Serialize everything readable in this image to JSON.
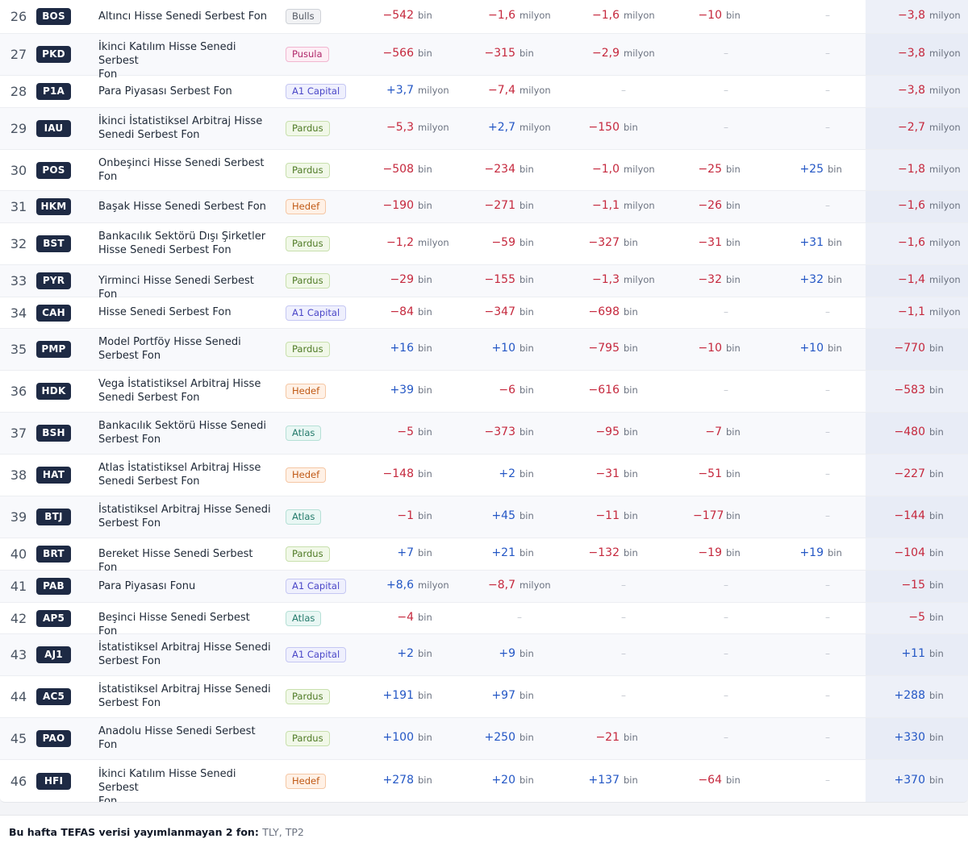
{
  "rows": [
    {
      "rank": "26",
      "ticker": "BOS",
      "name": [
        "Altıncı Hisse Senedi Serbest Fon"
      ],
      "manager": "Bulls",
      "mgr_class": "bulls",
      "cells": [
        [
          "−542",
          "bin"
        ],
        [
          "−1,6",
          "milyon"
        ],
        [
          "−1,6",
          "milyon"
        ],
        [
          "−10",
          "bin"
        ],
        [
          "–",
          ""
        ],
        [
          "−3,8",
          "milyon"
        ]
      ]
    },
    {
      "rank": "27",
      "ticker": "PKD",
      "name": [
        "İkinci Katılım Hisse Senedi Serbest",
        "Fon"
      ],
      "manager": "Pusula",
      "mgr_class": "pusula",
      "cells": [
        [
          "−566",
          "bin"
        ],
        [
          "−315",
          "bin"
        ],
        [
          "−2,9",
          "milyon"
        ],
        [
          "–",
          ""
        ],
        [
          "–",
          ""
        ],
        [
          "−3,8",
          "milyon"
        ]
      ]
    },
    {
      "rank": "28",
      "ticker": "P1A",
      "name": [
        "Para Piyasası Serbest Fon"
      ],
      "manager": "A1 Capital",
      "mgr_class": "a1",
      "cells": [
        [
          "+3,7",
          "milyon"
        ],
        [
          "−7,4",
          "milyon"
        ],
        [
          "–",
          ""
        ],
        [
          "–",
          ""
        ],
        [
          "–",
          ""
        ],
        [
          "−3,8",
          "milyon"
        ]
      ]
    },
    {
      "rank": "29",
      "ticker": "IAU",
      "name": [
        "İkinci İstatistiksel Arbitraj Hisse",
        "Senedi Serbest Fon"
      ],
      "manager": "Pardus",
      "mgr_class": "pardus",
      "cells": [
        [
          "−5,3",
          "milyon"
        ],
        [
          "+2,7",
          "milyon"
        ],
        [
          "−150",
          "bin"
        ],
        [
          "–",
          ""
        ],
        [
          "–",
          ""
        ],
        [
          "−2,7",
          "milyon"
        ]
      ]
    },
    {
      "rank": "30",
      "ticker": "POS",
      "name": [
        "Onbeşinci Hisse Senedi Serbest",
        "Fon"
      ],
      "manager": "Pardus",
      "mgr_class": "pardus",
      "cells": [
        [
          "−508",
          "bin"
        ],
        [
          "−234",
          "bin"
        ],
        [
          "−1,0",
          "milyon"
        ],
        [
          "−25",
          "bin"
        ],
        [
          "+25",
          "bin"
        ],
        [
          "−1,8",
          "milyon"
        ]
      ]
    },
    {
      "rank": "31",
      "ticker": "HKM",
      "name": [
        "Başak Hisse Senedi Serbest Fon"
      ],
      "manager": "Hedef",
      "mgr_class": "hedef",
      "cells": [
        [
          "−190",
          "bin"
        ],
        [
          "−271",
          "bin"
        ],
        [
          "−1,1",
          "milyon"
        ],
        [
          "−26",
          "bin"
        ],
        [
          "–",
          ""
        ],
        [
          "−1,6",
          "milyon"
        ]
      ]
    },
    {
      "rank": "32",
      "ticker": "BST",
      "name": [
        "Bankacılık Sektörü Dışı Şirketler",
        "Hisse Senedi Serbest Fon"
      ],
      "manager": "Pardus",
      "mgr_class": "pardus",
      "cells": [
        [
          "−1,2",
          "milyon"
        ],
        [
          "−59",
          "bin"
        ],
        [
          "−327",
          "bin"
        ],
        [
          "−31",
          "bin"
        ],
        [
          "+31",
          "bin"
        ],
        [
          "−1,6",
          "milyon"
        ]
      ]
    },
    {
      "rank": "33",
      "ticker": "PYR",
      "name": [
        "Yirminci Hisse Senedi Serbest Fon"
      ],
      "manager": "Pardus",
      "mgr_class": "pardus",
      "cells": [
        [
          "−29",
          "bin"
        ],
        [
          "−155",
          "bin"
        ],
        [
          "−1,3",
          "milyon"
        ],
        [
          "−32",
          "bin"
        ],
        [
          "+32",
          "bin"
        ],
        [
          "−1,4",
          "milyon"
        ]
      ]
    },
    {
      "rank": "34",
      "ticker": "CAH",
      "name": [
        "Hisse Senedi Serbest Fon"
      ],
      "manager": "A1 Capital",
      "mgr_class": "a1",
      "cells": [
        [
          "−84",
          "bin"
        ],
        [
          "−347",
          "bin"
        ],
        [
          "−698",
          "bin"
        ],
        [
          "–",
          ""
        ],
        [
          "–",
          ""
        ],
        [
          "−1,1",
          "milyon"
        ]
      ]
    },
    {
      "rank": "35",
      "ticker": "PMP",
      "name": [
        "Model Portföy Hisse Senedi",
        "Serbest Fon"
      ],
      "manager": "Pardus",
      "mgr_class": "pardus",
      "cells": [
        [
          "+16",
          "bin"
        ],
        [
          "+10",
          "bin"
        ],
        [
          "−795",
          "bin"
        ],
        [
          "−10",
          "bin"
        ],
        [
          "+10",
          "bin"
        ],
        [
          "−770",
          "bin"
        ]
      ]
    },
    {
      "rank": "36",
      "ticker": "HDK",
      "name": [
        "Vega İstatistiksel Arbitraj Hisse",
        "Senedi Serbest Fon"
      ],
      "manager": "Hedef",
      "mgr_class": "hedef",
      "cells": [
        [
          "+39",
          "bin"
        ],
        [
          "−6",
          "bin"
        ],
        [
          "−616",
          "bin"
        ],
        [
          "–",
          ""
        ],
        [
          "–",
          ""
        ],
        [
          "−583",
          "bin"
        ]
      ]
    },
    {
      "rank": "37",
      "ticker": "BSH",
      "name": [
        "Bankacılık Sektörü Hisse Senedi",
        "Serbest Fon"
      ],
      "manager": "Atlas",
      "mgr_class": "atlas",
      "cells": [
        [
          "−5",
          "bin"
        ],
        [
          "−373",
          "bin"
        ],
        [
          "−95",
          "bin"
        ],
        [
          "−7",
          "bin"
        ],
        [
          "–",
          ""
        ],
        [
          "−480",
          "bin"
        ]
      ]
    },
    {
      "rank": "38",
      "ticker": "HAT",
      "name": [
        "Atlas İstatistiksel Arbitraj Hisse",
        "Senedi Serbest Fon"
      ],
      "manager": "Hedef",
      "mgr_class": "hedef",
      "cells": [
        [
          "−148",
          "bin"
        ],
        [
          "+2",
          "bin"
        ],
        [
          "−31",
          "bin"
        ],
        [
          "−51",
          "bin"
        ],
        [
          "–",
          ""
        ],
        [
          "−227",
          "bin"
        ]
      ]
    },
    {
      "rank": "39",
      "ticker": "BTJ",
      "name": [
        "İstatistiksel Arbitraj Hisse Senedi",
        "Serbest Fon"
      ],
      "manager": "Atlas",
      "mgr_class": "atlas",
      "cells": [
        [
          "−1",
          "bin"
        ],
        [
          "+45",
          "bin"
        ],
        [
          "−11",
          "bin"
        ],
        [
          "−177",
          "bin"
        ],
        [
          "–",
          ""
        ],
        [
          "−144",
          "bin"
        ]
      ]
    },
    {
      "rank": "40",
      "ticker": "BRT",
      "name": [
        "Bereket Hisse Senedi Serbest Fon"
      ],
      "manager": "Pardus",
      "mgr_class": "pardus",
      "cells": [
        [
          "+7",
          "bin"
        ],
        [
          "+21",
          "bin"
        ],
        [
          "−132",
          "bin"
        ],
        [
          "−19",
          "bin"
        ],
        [
          "+19",
          "bin"
        ],
        [
          "−104",
          "bin"
        ]
      ]
    },
    {
      "rank": "41",
      "ticker": "PAB",
      "name": [
        "Para Piyasası Fonu"
      ],
      "manager": "A1 Capital",
      "mgr_class": "a1",
      "cells": [
        [
          "+8,6",
          "milyon"
        ],
        [
          "−8,7",
          "milyon"
        ],
        [
          "–",
          ""
        ],
        [
          "–",
          ""
        ],
        [
          "–",
          ""
        ],
        [
          "−15",
          "bin"
        ]
      ]
    },
    {
      "rank": "42",
      "ticker": "AP5",
      "name": [
        "Beşinci Hisse Senedi Serbest Fon"
      ],
      "manager": "Atlas",
      "mgr_class": "atlas",
      "cells": [
        [
          "−4",
          "bin"
        ],
        [
          "–",
          ""
        ],
        [
          "–",
          ""
        ],
        [
          "–",
          ""
        ],
        [
          "–",
          ""
        ],
        [
          "−5",
          "bin"
        ]
      ]
    },
    {
      "rank": "43",
      "ticker": "AJ1",
      "name": [
        "İstatistiksel Arbitraj Hisse Senedi",
        "Serbest Fon"
      ],
      "manager": "A1 Capital",
      "mgr_class": "a1",
      "cells": [
        [
          "+2",
          "bin"
        ],
        [
          "+9",
          "bin"
        ],
        [
          "–",
          ""
        ],
        [
          "–",
          ""
        ],
        [
          "–",
          ""
        ],
        [
          "+11",
          "bin"
        ]
      ]
    },
    {
      "rank": "44",
      "ticker": "AC5",
      "name": [
        "İstatistiksel Arbitraj Hisse Senedi",
        "Serbest Fon"
      ],
      "manager": "Pardus",
      "mgr_class": "pardus",
      "cells": [
        [
          "+191",
          "bin"
        ],
        [
          "+97",
          "bin"
        ],
        [
          "–",
          ""
        ],
        [
          "–",
          ""
        ],
        [
          "–",
          ""
        ],
        [
          "+288",
          "bin"
        ]
      ]
    },
    {
      "rank": "45",
      "ticker": "PAO",
      "name": [
        "Anadolu Hisse Senedi Serbest",
        "Fon"
      ],
      "manager": "Pardus",
      "mgr_class": "pardus",
      "cells": [
        [
          "+100",
          "bin"
        ],
        [
          "+250",
          "bin"
        ],
        [
          "−21",
          "bin"
        ],
        [
          "–",
          ""
        ],
        [
          "–",
          ""
        ],
        [
          "+330",
          "bin"
        ]
      ]
    },
    {
      "rank": "46",
      "ticker": "HFI",
      "name": [
        "İkinci Katılım Hisse Senedi Serbest",
        "Fon"
      ],
      "manager": "Hedef",
      "mgr_class": "hedef",
      "cells": [
        [
          "+278",
          "bin"
        ],
        [
          "+20",
          "bin"
        ],
        [
          "+137",
          "bin"
        ],
        [
          "−64",
          "bin"
        ],
        [
          "–",
          ""
        ],
        [
          "+370",
          "bin"
        ]
      ]
    }
  ],
  "footer": {
    "label": "Bu hafta TEFAS verisi yayımlanmayan 2 fon:",
    "list": "TLY, TP2"
  },
  "colors": {
    "negative": "#c5283d",
    "positive": "#2457c5",
    "ticker_bg": "#1e2a44"
  }
}
